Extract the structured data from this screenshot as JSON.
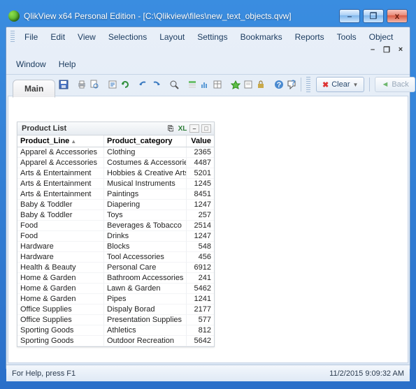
{
  "window": {
    "title": "QlikView x64 Personal Edition - [C:\\Qlikview\\files\\new_text_objects.qvw]"
  },
  "menu": [
    "File",
    "Edit",
    "View",
    "Selections",
    "Layout",
    "Settings",
    "Bookmarks",
    "Reports",
    "Tools",
    "Object",
    "Window",
    "Help"
  ],
  "toolbar_right": {
    "clear_label": "Clear",
    "back_label": "Back"
  },
  "tabs": {
    "active": "Main"
  },
  "table": {
    "caption": "Product List",
    "columns": [
      "Product_Line",
      "Product_category",
      "Value"
    ],
    "rows": [
      {
        "line": "Apparel & Accessories",
        "cat": "Clothing",
        "val": "2365"
      },
      {
        "line": "Apparel & Accessories",
        "cat": "Costumes & Accessories",
        "val": "4487"
      },
      {
        "line": "Arts & Entertainment",
        "cat": "Hobbies & Creative Arts",
        "val": "5201"
      },
      {
        "line": "Arts & Entertainment",
        "cat": "Musical Instruments",
        "val": "1245"
      },
      {
        "line": "Arts & Entertainment",
        "cat": "Paintings",
        "val": "8451"
      },
      {
        "line": "Baby & Toddler",
        "cat": "Diapering",
        "val": "1247"
      },
      {
        "line": "Baby & Toddler",
        "cat": "Toys",
        "val": "257"
      },
      {
        "line": "Food",
        "cat": "Beverages & Tobacco",
        "val": "2514"
      },
      {
        "line": "Food",
        "cat": "Drinks",
        "val": "1247"
      },
      {
        "line": "Hardware",
        "cat": "Blocks",
        "val": "548"
      },
      {
        "line": "Hardware",
        "cat": "Tool Accessories",
        "val": "456"
      },
      {
        "line": "Health & Beauty",
        "cat": "Personal Care",
        "val": "6912"
      },
      {
        "line": "Home & Garden",
        "cat": "Bathroom Accessories",
        "val": "241"
      },
      {
        "line": "Home & Garden",
        "cat": "Lawn & Garden",
        "val": "5462"
      },
      {
        "line": "Home & Garden",
        "cat": "Pipes",
        "val": "1241"
      },
      {
        "line": "Office Supplies",
        "cat": "Dispaly Borad",
        "val": "2177"
      },
      {
        "line": "Office Supplies",
        "cat": "Presentation Supplies",
        "val": "577"
      },
      {
        "line": "Sporting Goods",
        "cat": "Athletics",
        "val": "812"
      },
      {
        "line": "Sporting Goods",
        "cat": "Outdoor Recreation",
        "val": "5642"
      }
    ]
  },
  "status": {
    "left": "For Help, press F1",
    "right": "11/2/2015 9:09:32 AM"
  }
}
